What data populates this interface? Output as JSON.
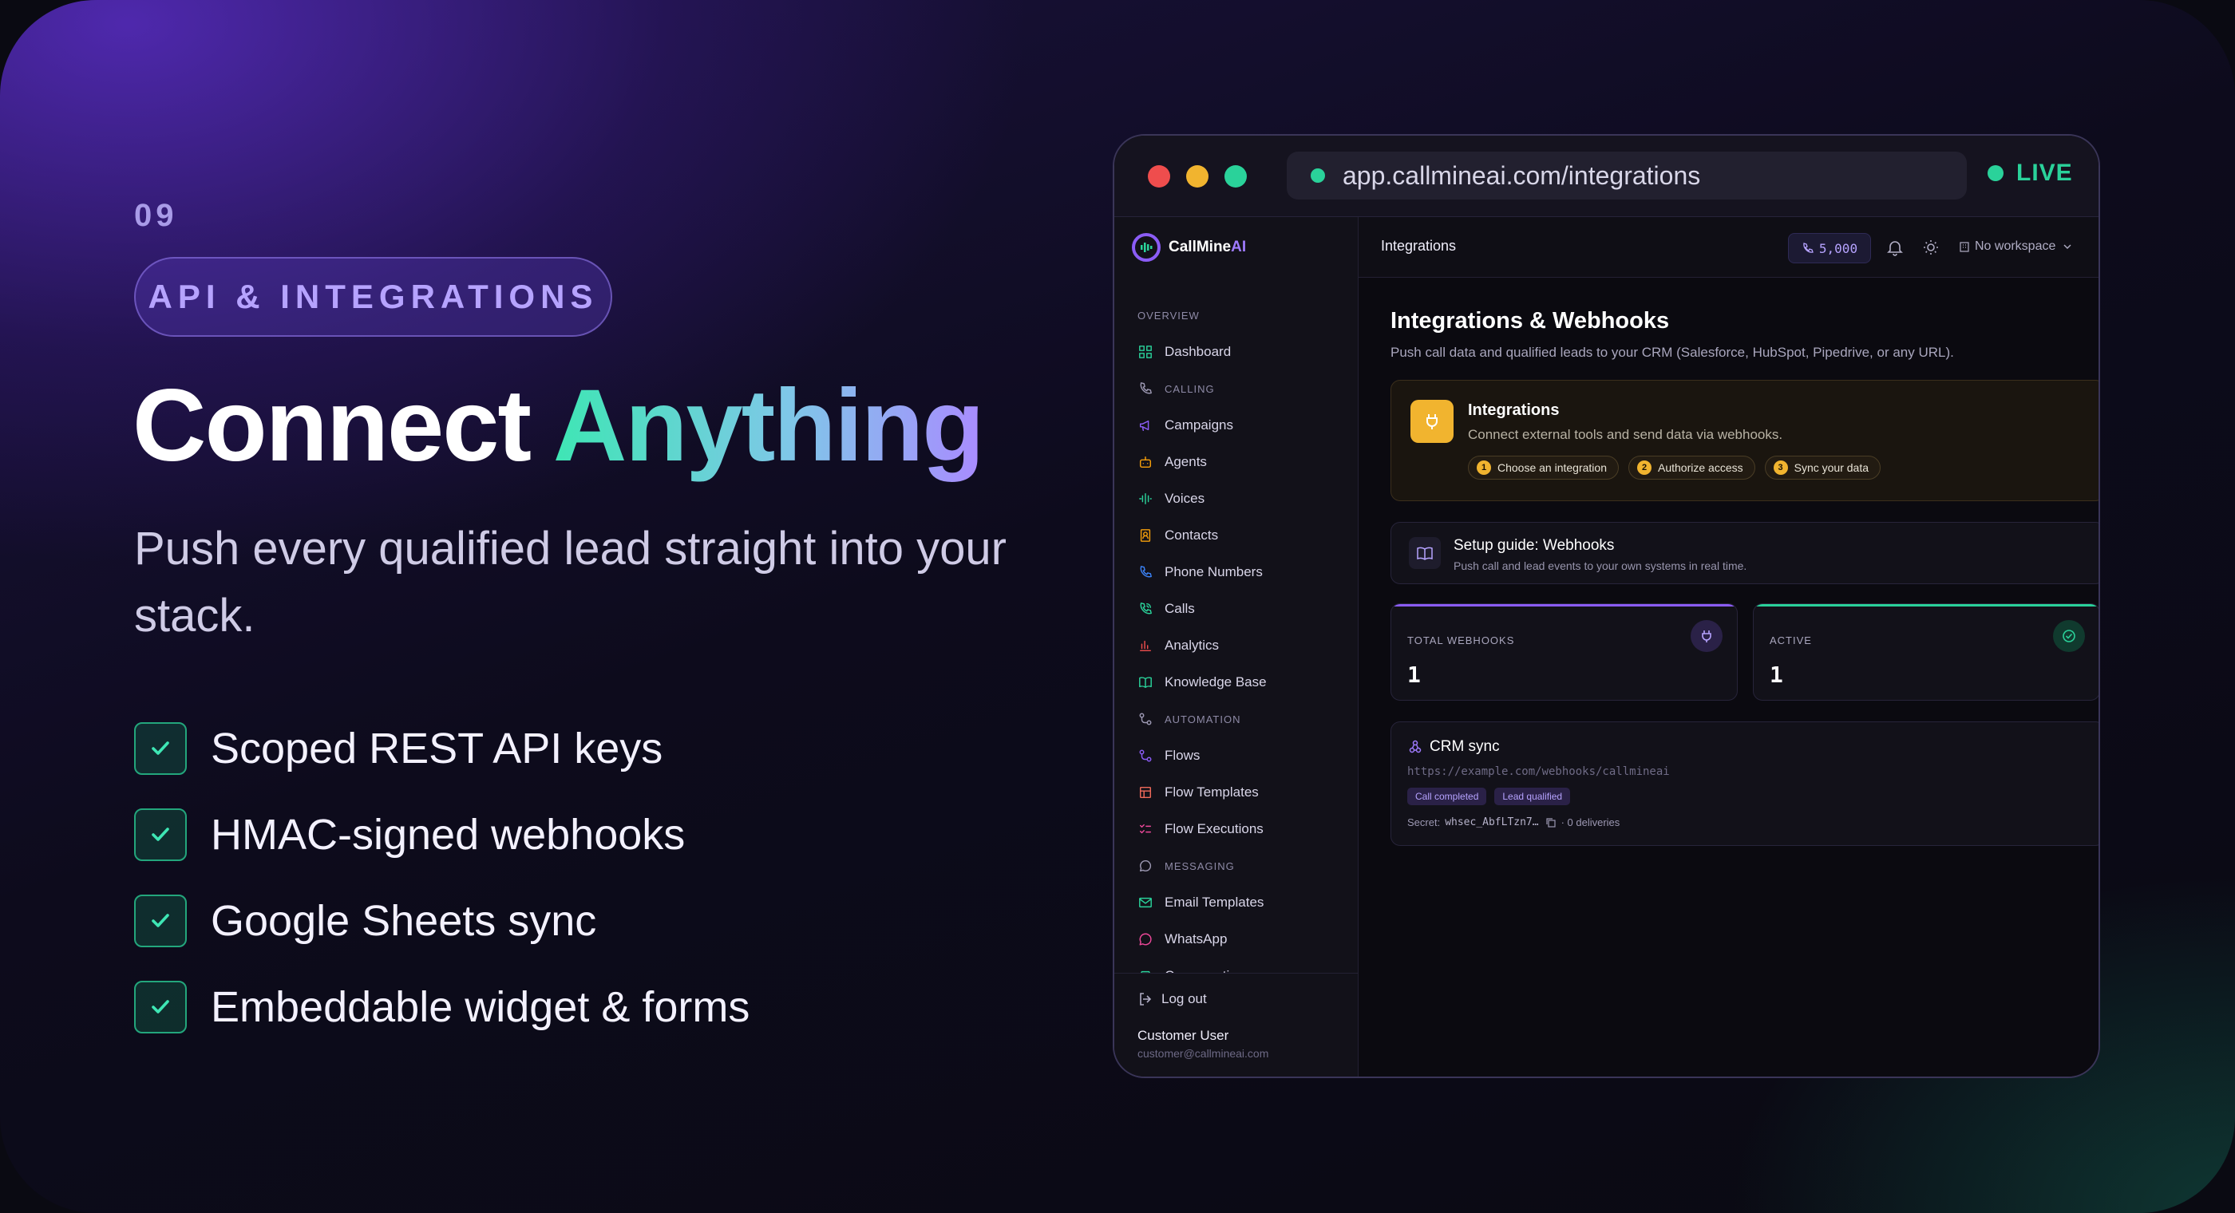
{
  "slide": {
    "number": "09",
    "category": "API & INTEGRATIONS",
    "headline_start": "Connect ",
    "headline_highlight": "Anything",
    "subtitle": "Push every qualified lead straight into your stack.",
    "features": [
      "Scoped REST API keys",
      "HMAC-signed webhooks",
      "Google Sheets sync",
      "Embeddable widget & forms"
    ]
  },
  "browser": {
    "url": "app.callmineai.com/integrations",
    "status": "LIVE"
  },
  "app": {
    "brand_main": "CallMine",
    "brand_accent": "AI",
    "header_title": "Integrations",
    "credits": "5,000",
    "workspace": "No workspace",
    "sidebar": {
      "items": [
        {
          "type": "section",
          "label": "OVERVIEW",
          "icon": ""
        },
        {
          "type": "item",
          "label": "Dashboard",
          "icon": "grid-icon"
        },
        {
          "type": "section",
          "label": "CALLING",
          "icon": "phone-icon"
        },
        {
          "type": "item",
          "label": "Campaigns",
          "icon": "megaphone-icon"
        },
        {
          "type": "item",
          "label": "Agents",
          "icon": "bot-icon"
        },
        {
          "type": "item",
          "label": "Voices",
          "icon": "waveform-icon"
        },
        {
          "type": "item",
          "label": "Contacts",
          "icon": "contact-book-icon"
        },
        {
          "type": "item",
          "label": "Phone Numbers",
          "icon": "phone-icon"
        },
        {
          "type": "item",
          "label": "Calls",
          "icon": "phone-call-icon"
        },
        {
          "type": "item",
          "label": "Analytics",
          "icon": "bar-chart-icon"
        },
        {
          "type": "item",
          "label": "Knowledge Base",
          "icon": "book-open-icon"
        },
        {
          "type": "section",
          "label": "AUTOMATION",
          "icon": "workflow-icon"
        },
        {
          "type": "item",
          "label": "Flows",
          "icon": "workflow-icon"
        },
        {
          "type": "item",
          "label": "Flow Templates",
          "icon": "template-icon"
        },
        {
          "type": "item",
          "label": "Flow Executions",
          "icon": "list-checks-icon"
        },
        {
          "type": "section",
          "label": "MESSAGING",
          "icon": "chat-bubble-icon"
        },
        {
          "type": "item",
          "label": "Email Templates",
          "icon": "mail-icon"
        },
        {
          "type": "item",
          "label": "WhatsApp",
          "icon": "whatsapp-icon"
        },
        {
          "type": "item",
          "label": "Conversations",
          "icon": "inbox-icon"
        }
      ],
      "logout": "Log out",
      "user_name": "Customer User",
      "user_email": "customer@callmineai.com"
    },
    "page": {
      "title": "Integrations & Webhooks",
      "subtitle": "Push call data and qualified leads to your CRM (Salesforce, HubSpot, Pipedrive, or any URL).",
      "integrations_card": {
        "title": "Integrations",
        "description": "Connect external tools and send data via webhooks.",
        "steps": [
          {
            "n": "1",
            "label": "Choose an integration"
          },
          {
            "n": "2",
            "label": "Authorize access"
          },
          {
            "n": "3",
            "label": "Sync your data"
          }
        ]
      },
      "guide": {
        "title": "Setup guide: Webhooks",
        "description": "Push call and lead events to your own systems in real time."
      },
      "stats": [
        {
          "label": "TOTAL WEBHOOKS",
          "value": "1",
          "color": "#8b5cf6",
          "icon": "plug-icon"
        },
        {
          "label": "ACTIVE",
          "value": "1",
          "color": "#2ad29a",
          "icon": "check-circle-icon"
        }
      ],
      "webhook": {
        "name": "CRM sync",
        "url": "https://example.com/webhooks/callmineai",
        "events": [
          "Call completed",
          "Lead qualified"
        ],
        "secret_label": "Secret:",
        "secret_value": "whsec_AbfLTzn7…",
        "deliveries": "· 0 deliveries"
      }
    }
  },
  "colors": {
    "accent_purple": "#8b5cf6",
    "accent_green": "#2ad29a",
    "accent_amber": "#f1b42f"
  }
}
